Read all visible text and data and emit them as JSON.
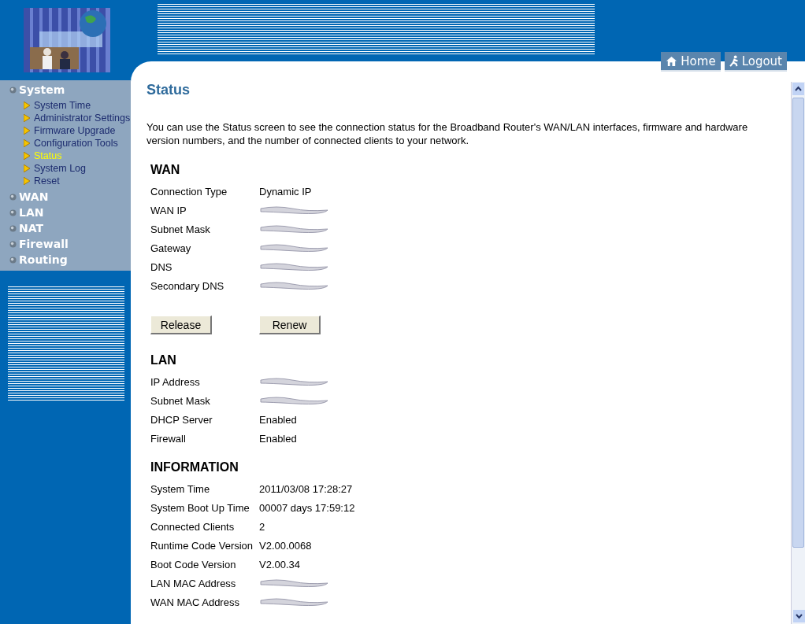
{
  "header": {
    "buttons": [
      {
        "label": "Home",
        "kind": "home"
      },
      {
        "label": "Logout",
        "kind": "logout"
      }
    ]
  },
  "sidebar": {
    "items": [
      {
        "label": "System",
        "children": [
          {
            "label": "System Time",
            "selected": false
          },
          {
            "label": "Administrator Settings",
            "selected": false
          },
          {
            "label": "Firmware Upgrade",
            "selected": false
          },
          {
            "label": "Configuration Tools",
            "selected": false
          },
          {
            "label": "Status",
            "selected": true
          },
          {
            "label": "System Log",
            "selected": false
          },
          {
            "label": "Reset",
            "selected": false
          }
        ]
      },
      {
        "label": "WAN"
      },
      {
        "label": "LAN"
      },
      {
        "label": "NAT"
      },
      {
        "label": "Firewall"
      },
      {
        "label": "Routing"
      }
    ]
  },
  "page": {
    "title": "Status",
    "intro": "You can use the Status screen to see the connection status for the Broadband Router's WAN/LAN interfaces, firmware and hardware version numbers, and the number of connected clients to your network.",
    "sections": [
      {
        "title": "WAN",
        "rows": [
          {
            "label": "Connection Type",
            "value": "Dynamic IP"
          },
          {
            "label": "WAN IP",
            "kind": "redacted"
          },
          {
            "label": "Subnet Mask",
            "kind": "redacted"
          },
          {
            "label": "Gateway",
            "kind": "redacted"
          },
          {
            "label": "DNS",
            "kind": "redacted"
          },
          {
            "label": "Secondary DNS",
            "kind": "redacted"
          }
        ],
        "buttons": [
          "Release",
          "Renew"
        ]
      },
      {
        "title": "LAN",
        "rows": [
          {
            "label": "IP Address",
            "kind": "redacted"
          },
          {
            "label": "Subnet Mask",
            "kind": "redacted"
          },
          {
            "label": "DHCP Server",
            "value": "Enabled"
          },
          {
            "label": "Firewall",
            "value": "Enabled"
          }
        ]
      },
      {
        "title": "INFORMATION",
        "rows": [
          {
            "label": "System Time",
            "value": "2011/03/08 17:28:27"
          },
          {
            "label": "System Boot Up Time",
            "value": "00007 days 17:59:12"
          },
          {
            "label": "Connected Clients",
            "value": "2"
          },
          {
            "label": "Runtime Code Version",
            "value": "V2.00.0068"
          },
          {
            "label": "Boot Code Version",
            "value": "V2.00.34"
          },
          {
            "label": "LAN MAC Address",
            "kind": "redacted"
          },
          {
            "label": "WAN MAC Address",
            "kind": "redacted"
          }
        ]
      }
    ]
  }
}
